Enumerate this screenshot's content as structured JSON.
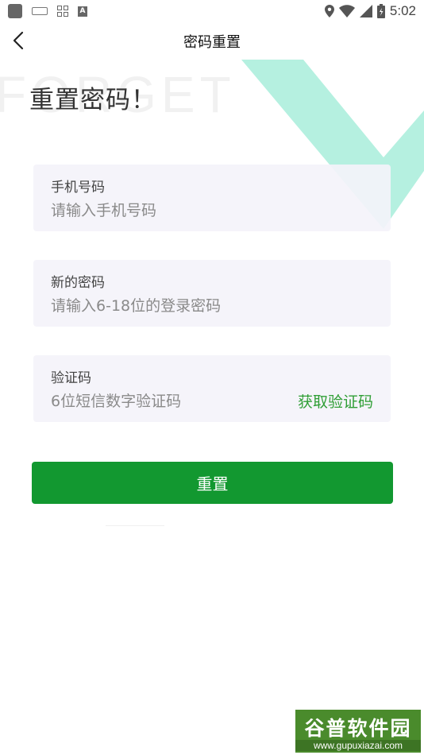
{
  "status_bar": {
    "time": "5:02",
    "icons": [
      "app-icon",
      "keyboard-icon",
      "grid-icon",
      "text-a-icon",
      "location-icon",
      "wifi-icon",
      "signal-icon",
      "battery-icon"
    ]
  },
  "nav": {
    "title": "密码重置",
    "back_icon": "back-arrow-icon"
  },
  "decoration": {
    "bg_text": "FORGET",
    "check_color": "#b5f0e0"
  },
  "heading": "重置密码！",
  "form": {
    "phone": {
      "label": "手机号码",
      "placeholder": "请输入手机号码",
      "value": ""
    },
    "password": {
      "label": "新的密码",
      "placeholder": "请输入6-18位的登录密码",
      "value": ""
    },
    "code": {
      "label": "验证码",
      "placeholder": "6位短信数字验证码",
      "value": "",
      "get_code_label": "获取验证码"
    },
    "submit_label": "重置"
  },
  "watermark": {
    "title": "谷普软件园",
    "url": "www.gupuxiazai.com"
  },
  "colors": {
    "primary": "#129830",
    "link": "#2f9e35",
    "field_bg": "#f4f3fa"
  }
}
